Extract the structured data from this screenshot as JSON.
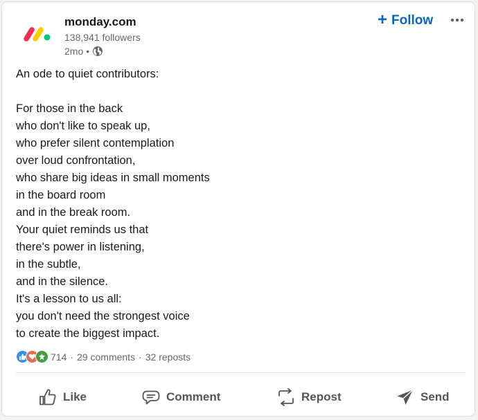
{
  "company": {
    "name": "monday.com",
    "followers": "138,941 followers",
    "time": "2mo",
    "meta_sep": "•"
  },
  "follow_button": {
    "plus": "+",
    "label": "Follow"
  },
  "post": {
    "lines": [
      "An ode to quiet contributors:",
      "",
      "For those in the back",
      "who don't like to speak up,",
      "who prefer silent contemplation",
      "over loud confrontation,",
      "who share big ideas in small moments",
      "in the board room",
      "and in the break room.",
      "Your quiet reminds us that",
      "there's power in listening,",
      "in the subtle,",
      "and in the silence.",
      "It's a lesson to us all:",
      "you don't need the strongest voice",
      "to create the biggest impact."
    ]
  },
  "social": {
    "reactions_count": "714",
    "sep": "·",
    "comments": "29 comments",
    "reposts": "32 reposts",
    "reaction_icons": [
      "like-reaction-icon",
      "love-reaction-icon",
      "insightful-reaction-icon"
    ]
  },
  "actions": {
    "like": "Like",
    "comment": "Comment",
    "repost": "Repost",
    "send": "Send"
  },
  "colors": {
    "accent": "#0a66c2",
    "logo_red": "#f62b54",
    "logo_yellow": "#ffcc00",
    "logo_green": "#00ca72",
    "like": "#378fe9",
    "love": "#df704d",
    "insightful": "#4b9b45"
  }
}
